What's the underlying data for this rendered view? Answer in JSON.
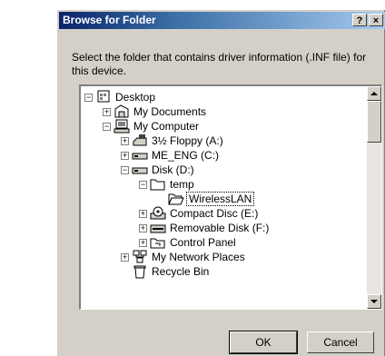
{
  "dialog": {
    "title": "Browse for Folder",
    "help_label": "?",
    "close_label": "×",
    "instruction": "Select the folder that contains driver information (.INF file) for this device."
  },
  "tree": [
    {
      "label": "Desktop",
      "icon": "desktop-icon",
      "expander": "−"
    },
    {
      "label": "My Documents",
      "icon": "folder-documents-icon",
      "expander": "+"
    },
    {
      "label": "My Computer",
      "icon": "computer-icon",
      "expander": "−"
    },
    {
      "label": "3½ Floppy (A:)",
      "icon": "floppy-drive-icon",
      "expander": "+"
    },
    {
      "label": "ME_ENG (C:)",
      "icon": "hard-drive-icon",
      "expander": "+"
    },
    {
      "label": "Disk (D:)",
      "icon": "hard-drive-icon",
      "expander": "−"
    },
    {
      "label": "temp",
      "icon": "folder-icon",
      "expander": "−"
    },
    {
      "label": "WirelessLAN",
      "icon": "open-folder-icon",
      "expander": ""
    },
    {
      "label": "Compact Disc (E:)",
      "icon": "cd-drive-icon",
      "expander": "+"
    },
    {
      "label": "Removable Disk (F:)",
      "icon": "removable-drive-icon",
      "expander": "+"
    },
    {
      "label": "Control Panel",
      "icon": "control-panel-icon",
      "expander": "+"
    },
    {
      "label": "My Network Places",
      "icon": "network-places-icon",
      "expander": "+"
    },
    {
      "label": "Recycle Bin",
      "icon": "recycle-bin-icon",
      "expander": ""
    }
  ],
  "buttons": {
    "ok": "OK",
    "cancel": "Cancel"
  },
  "colors": {
    "title_start": "#0a246a",
    "title_end": "#a6caf0",
    "face": "#d4d0c8"
  }
}
